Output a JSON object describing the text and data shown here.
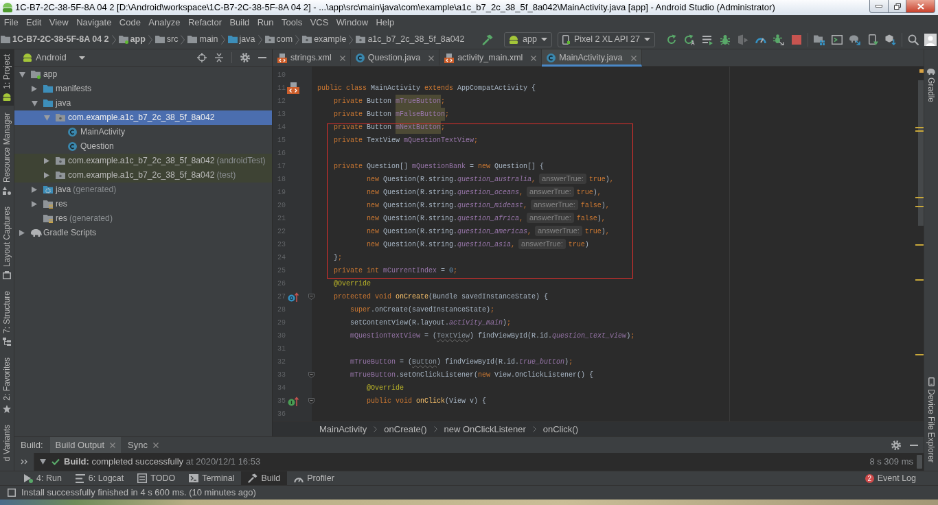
{
  "window": {
    "title": "1C-B7-2C-38-5F-8A 04 2 [D:\\Android\\workspace\\1C-B7-2C-38-5F-8A 04 2] - ...\\app\\src\\main\\java\\com\\example\\a1c_b7_2c_38_5f_8a042\\MainActivity.java [app] - Android Studio (Administrator)"
  },
  "menu": [
    "File",
    "Edit",
    "View",
    "Navigate",
    "Code",
    "Analyze",
    "Refactor",
    "Build",
    "Run",
    "Tools",
    "VCS",
    "Window",
    "Help"
  ],
  "nav_bar": {
    "crumbs": [
      {
        "label": "1C-B7-2C-38-5F-8A 04 2",
        "kind": "project"
      },
      {
        "label": "app",
        "kind": "module"
      },
      {
        "label": "src",
        "kind": "folder"
      },
      {
        "label": "main",
        "kind": "folder"
      },
      {
        "label": "java",
        "kind": "source"
      },
      {
        "label": "com",
        "kind": "package"
      },
      {
        "label": "example",
        "kind": "package"
      },
      {
        "label": "a1c_b7_2c_38_5f_8a042",
        "kind": "package"
      }
    ],
    "run_config": "app",
    "device": "Pixel 2 XL API 27"
  },
  "left_tool_strip": [
    {
      "label": "1: Project",
      "kind": "android",
      "selected": true
    },
    {
      "label": "Resource Manager",
      "kind": "shapes",
      "selected": false
    },
    {
      "label": "Layout Captures",
      "kind": "capture",
      "selected": false
    },
    {
      "label": "7: Structure",
      "kind": "structure",
      "selected": false
    },
    {
      "label": "2: Favorites",
      "kind": "star",
      "selected": false
    },
    {
      "label": "d Variants",
      "kind": "none",
      "selected": false
    }
  ],
  "project_panel": {
    "view": "Android",
    "tree": [
      {
        "label": "app",
        "kind": "module",
        "expanded": true,
        "selected": false,
        "test_scope": false,
        "children": [
          {
            "label": "manifests",
            "kind": "source",
            "expanded": false,
            "selected": false,
            "test_scope": false
          },
          {
            "label": "java",
            "kind": "source",
            "expanded": true,
            "selected": false,
            "test_scope": false,
            "children": [
              {
                "label": "com.example.a1c_b7_2c_38_5f_8a042",
                "kind": "package",
                "expanded": true,
                "selected": true,
                "test_scope": false,
                "children": [
                  {
                    "label": "MainActivity",
                    "kind": "class",
                    "selected": false,
                    "test_scope": false
                  },
                  {
                    "label": "Question",
                    "kind": "class",
                    "selected": false,
                    "test_scope": false
                  }
                ]
              },
              {
                "label": "com.example.a1c_b7_2c_38_5f_8a042",
                "note": "(androidTest)",
                "kind": "package",
                "expanded": false,
                "selected": false,
                "test_scope": true
              },
              {
                "label": "com.example.a1c_b7_2c_38_5f_8a042",
                "note": "(test)",
                "kind": "package",
                "expanded": false,
                "selected": false,
                "test_scope": true
              }
            ]
          },
          {
            "label": "java",
            "note": "(generated)",
            "kind": "generated",
            "expanded": false,
            "selected": false,
            "test_scope": false
          },
          {
            "label": "res",
            "kind": "res",
            "expanded": false,
            "selected": false,
            "test_scope": false
          },
          {
            "label": "res",
            "note": "(generated)",
            "kind": "res",
            "selected": false,
            "test_scope": false
          }
        ]
      },
      {
        "label": "Gradle Scripts",
        "kind": "gradle",
        "expanded": false,
        "selected": false,
        "test_scope": false
      }
    ]
  },
  "editor": {
    "tabs": [
      {
        "label": "strings.xml",
        "kind": "xml",
        "selected": false
      },
      {
        "label": "Question.java",
        "kind": "class",
        "selected": false
      },
      {
        "label": "activity_main.xml",
        "kind": "xml",
        "selected": false
      },
      {
        "label": "MainActivity.java",
        "kind": "class",
        "selected": true
      }
    ],
    "lines": [
      {
        "kind": "line",
        "number": "10",
        "fold": false
      },
      {
        "kind": "line",
        "number": "11",
        "gutter": {
          "kind": "layout"
        },
        "fold": false,
        "tokens": [
          {
            "kind": "kw",
            "text": "public class "
          },
          {
            "kind": "plain",
            "text": "MainActivity "
          },
          {
            "kind": "kw",
            "text": "extends "
          },
          {
            "kind": "plain",
            "text": "AppCompatActivity {"
          }
        ]
      },
      {
        "kind": "line",
        "number": "12",
        "fold": false,
        "tokens": [
          {
            "kind": "kw",
            "text": "    private "
          },
          {
            "kind": "plain",
            "text": "Button "
          },
          {
            "kind": "field-hl",
            "text": "mTrueButton"
          },
          {
            "kind": "kw",
            "text": ";"
          }
        ]
      },
      {
        "kind": "line",
        "number": "13",
        "fold": false,
        "tokens": [
          {
            "kind": "kw",
            "text": "    private "
          },
          {
            "kind": "plain",
            "text": "Button "
          },
          {
            "kind": "field-hl",
            "text": "mFalseButton"
          },
          {
            "kind": "kw",
            "text": ";"
          }
        ]
      },
      {
        "kind": "frame",
        "lines": [
          {
            "kind": "line",
            "number": "14",
            "fold": false,
            "tokens": [
              {
                "kind": "kw",
                "text": "    private "
              },
              {
                "kind": "plain",
                "text": "Button "
              },
              {
                "kind": "field-hl",
                "text": "mNextButton"
              },
              {
                "kind": "kw",
                "text": ";"
              }
            ]
          },
          {
            "kind": "line",
            "number": "15",
            "fold": false,
            "tokens": [
              {
                "kind": "kw",
                "text": "    private "
              },
              {
                "kind": "plain",
                "text": "TextView "
              },
              {
                "kind": "field",
                "text": "mQuestionTextView"
              },
              {
                "kind": "kw",
                "text": ";"
              }
            ]
          },
          {
            "kind": "line",
            "number": "16",
            "fold": false
          },
          {
            "kind": "line",
            "number": "17",
            "fold": false,
            "tokens": [
              {
                "kind": "kw",
                "text": "    private "
              },
              {
                "kind": "plain",
                "text": "Question[] "
              },
              {
                "kind": "field",
                "text": "mQuestionBank"
              },
              {
                "kind": "plain",
                "text": " = "
              },
              {
                "kind": "kw",
                "text": "new "
              },
              {
                "kind": "plain",
                "text": "Question[] {"
              }
            ]
          },
          {
            "kind": "line",
            "number": "18",
            "fold": false,
            "tokens": [
              {
                "kind": "kw",
                "text": "            new "
              },
              {
                "kind": "plain",
                "text": "Question(R.string."
              },
              {
                "kind": "static",
                "text": "question_australia"
              },
              {
                "kind": "kw",
                "text": ","
              },
              {
                "kind": "hint",
                "text": "answerTrue:"
              },
              {
                "kind": "kw",
                "text": "true"
              },
              {
                "kind": "plain",
                "text": ")"
              },
              {
                "kind": "kw",
                "text": ","
              }
            ]
          },
          {
            "kind": "line",
            "number": "19",
            "fold": false,
            "tokens": [
              {
                "kind": "kw",
                "text": "            new "
              },
              {
                "kind": "plain",
                "text": "Question(R.string."
              },
              {
                "kind": "static",
                "text": "question_oceans"
              },
              {
                "kind": "kw",
                "text": ","
              },
              {
                "kind": "hint",
                "text": "answerTrue:"
              },
              {
                "kind": "kw",
                "text": "true"
              },
              {
                "kind": "plain",
                "text": ")"
              },
              {
                "kind": "kw",
                "text": ","
              }
            ]
          },
          {
            "kind": "line",
            "number": "20",
            "fold": false,
            "tokens": [
              {
                "kind": "kw",
                "text": "            new "
              },
              {
                "kind": "plain",
                "text": "Question(R.string."
              },
              {
                "kind": "static",
                "text": "question_mideast"
              },
              {
                "kind": "kw",
                "text": ","
              },
              {
                "kind": "hint",
                "text": "answerTrue:"
              },
              {
                "kind": "kw",
                "text": "false"
              },
              {
                "kind": "plain",
                "text": ")"
              },
              {
                "kind": "kw",
                "text": ","
              }
            ]
          },
          {
            "kind": "line",
            "number": "21",
            "fold": false,
            "tokens": [
              {
                "kind": "kw",
                "text": "            new "
              },
              {
                "kind": "plain",
                "text": "Question(R.string."
              },
              {
                "kind": "static",
                "text": "question_africa"
              },
              {
                "kind": "kw",
                "text": ","
              },
              {
                "kind": "hint",
                "text": "answerTrue:"
              },
              {
                "kind": "kw",
                "text": "false"
              },
              {
                "kind": "plain",
                "text": ")"
              },
              {
                "kind": "kw",
                "text": ","
              }
            ]
          },
          {
            "kind": "line",
            "number": "22",
            "fold": false,
            "tokens": [
              {
                "kind": "kw",
                "text": "            new "
              },
              {
                "kind": "plain",
                "text": "Question(R.string."
              },
              {
                "kind": "static",
                "text": "question_americas"
              },
              {
                "kind": "kw",
                "text": ","
              },
              {
                "kind": "hint",
                "text": "answerTrue:"
              },
              {
                "kind": "kw",
                "text": "true"
              },
              {
                "kind": "plain",
                "text": ")"
              },
              {
                "kind": "kw",
                "text": ","
              }
            ]
          },
          {
            "kind": "line",
            "number": "23",
            "fold": false,
            "tokens": [
              {
                "kind": "kw",
                "text": "            new "
              },
              {
                "kind": "plain",
                "text": "Question(R.string."
              },
              {
                "kind": "static",
                "text": "question_asia"
              },
              {
                "kind": "kw",
                "text": ","
              },
              {
                "kind": "hint",
                "text": "answerTrue:"
              },
              {
                "kind": "kw",
                "text": "true"
              },
              {
                "kind": "plain",
                "text": ")"
              }
            ]
          },
          {
            "kind": "line",
            "number": "24",
            "fold": false,
            "tokens": [
              {
                "kind": "plain",
                "text": "    }"
              },
              {
                "kind": "kw",
                "text": ";"
              }
            ]
          },
          {
            "kind": "line",
            "number": "25",
            "fold": false,
            "tokens": [
              {
                "kind": "kw",
                "text": "    private int "
              },
              {
                "kind": "field",
                "text": "mCurrentIndex"
              },
              {
                "kind": "plain",
                "text": " = "
              },
              {
                "kind": "num",
                "text": "0"
              },
              {
                "kind": "kw",
                "text": ";"
              }
            ]
          }
        ]
      },
      {
        "kind": "line",
        "number": "26",
        "fold": false,
        "tokens": [
          {
            "kind": "ann",
            "text": "    @Override"
          }
        ]
      },
      {
        "kind": "line",
        "number": "27",
        "gutter": {
          "kind": "override"
        },
        "fold": true,
        "tokens": [
          {
            "kind": "kw",
            "text": "    protected void "
          },
          {
            "kind": "method",
            "text": "onCreate"
          },
          {
            "kind": "plain",
            "text": "(Bundle savedInstanceState) {"
          }
        ]
      },
      {
        "kind": "line",
        "number": "28",
        "fold": false,
        "tokens": [
          {
            "kind": "kw",
            "text": "        super"
          },
          {
            "kind": "plain",
            "text": ".onCreate(savedInstanceState)"
          },
          {
            "kind": "kw",
            "text": ";"
          }
        ]
      },
      {
        "kind": "line",
        "number": "29",
        "fold": false,
        "tokens": [
          {
            "kind": "plain",
            "text": "        setContentView(R.layout."
          },
          {
            "kind": "static",
            "text": "activity_main"
          },
          {
            "kind": "plain",
            "text": ")"
          },
          {
            "kind": "kw",
            "text": ";"
          }
        ]
      },
      {
        "kind": "line",
        "number": "30",
        "fold": false,
        "tokens": [
          {
            "kind": "field",
            "text": "        mQuestionTextView"
          },
          {
            "kind": "plain",
            "text": " = ("
          },
          {
            "kind": "cast",
            "text": "TextView"
          },
          {
            "kind": "plain",
            "text": ") findViewById(R.id."
          },
          {
            "kind": "static",
            "text": "question_text_view"
          },
          {
            "kind": "plain",
            "text": ")"
          },
          {
            "kind": "kw",
            "text": ";"
          }
        ]
      },
      {
        "kind": "line",
        "number": "31",
        "fold": false
      },
      {
        "kind": "line",
        "number": "32",
        "fold": false,
        "tokens": [
          {
            "kind": "field",
            "text": "        mTrueButton"
          },
          {
            "kind": "plain",
            "text": " = ("
          },
          {
            "kind": "cast",
            "text": "Button"
          },
          {
            "kind": "plain",
            "text": ") findViewById(R.id."
          },
          {
            "kind": "static",
            "text": "true_button"
          },
          {
            "kind": "plain",
            "text": ")"
          },
          {
            "kind": "kw",
            "text": ";"
          }
        ]
      },
      {
        "kind": "line",
        "number": "33",
        "fold": true,
        "tokens": [
          {
            "kind": "field",
            "text": "        mTrueButton"
          },
          {
            "kind": "plain",
            "text": ".setOnClickListener("
          },
          {
            "kind": "kw",
            "text": "new "
          },
          {
            "kind": "plain",
            "text": "View.OnClickListener() {"
          }
        ]
      },
      {
        "kind": "line",
        "number": "34",
        "fold": false,
        "tokens": [
          {
            "kind": "ann",
            "text": "            @Override"
          }
        ]
      },
      {
        "kind": "line",
        "number": "35",
        "gutter": {
          "kind": "implement"
        },
        "fold": true,
        "tokens": [
          {
            "kind": "kw",
            "text": "            public void "
          },
          {
            "kind": "method",
            "text": "onClick"
          },
          {
            "kind": "plain",
            "text": "(View v) {"
          }
        ]
      },
      {
        "kind": "line",
        "number": "36",
        "fold": false
      }
    ],
    "breadcrumbs": [
      "MainActivity",
      "onCreate()",
      "new OnClickListener",
      "onClick()"
    ]
  },
  "right_tool_strip": [
    {
      "label": "Gradle",
      "kind": "gradle"
    },
    {
      "label": "Device File Explorer",
      "kind": "device"
    }
  ],
  "build_panel": {
    "title": "Build:",
    "tabs": [
      {
        "label": "Build Output",
        "selected": true
      },
      {
        "label": "Sync",
        "selected": false
      }
    ],
    "result": {
      "expanded": true,
      "succeeded": true,
      "label": "Build:",
      "message": "completed successfully",
      "time": "at 2020/12/1 16:53",
      "duration": "8 s 309 ms"
    }
  },
  "tool_window_bar": {
    "items": [
      {
        "label": "4: Run",
        "kind": "run",
        "selected": false
      },
      {
        "label": "6: Logcat",
        "kind": "logcat",
        "selected": false
      },
      {
        "label": "TODO",
        "kind": "todo",
        "selected": false
      },
      {
        "label": "Terminal",
        "kind": "terminal",
        "selected": false
      },
      {
        "label": "Build",
        "kind": "build",
        "selected": true
      },
      {
        "label": "Profiler",
        "kind": "profiler",
        "selected": false
      }
    ],
    "event_log": {
      "label": "Event Log",
      "count": "2"
    }
  },
  "status_bar": {
    "message": "Install successfully finished in 4 s 600 ms. (10 minutes ago)"
  }
}
